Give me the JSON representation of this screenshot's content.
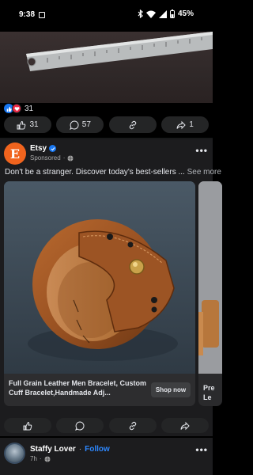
{
  "status_bar": {
    "time": "9:38",
    "battery": "45%"
  },
  "prev_post": {
    "reaction_count": "31",
    "actions": {
      "like_count": "31",
      "comment_count": "57",
      "share_count": "1"
    }
  },
  "ad": {
    "advertiser": "Etsy",
    "avatar_letter": "E",
    "sponsored_label": "Sponsored",
    "body_text": "Don't be a stranger. Discover today's best-sellers ...",
    "see_more": "See more",
    "card": {
      "title": "Full Grain Leather Men Bracelet, Custom Cuff Bracelet,Handmade Adj...",
      "cta": "Shop now"
    },
    "card2": {
      "title_line1": "Pre",
      "title_line2": "Le"
    }
  },
  "next_post": {
    "author": "Staffy Lover",
    "separator": "·",
    "follow_label": "Follow",
    "time": "7h",
    "time_separator": "·"
  },
  "colors": {
    "background": "#000000",
    "card": "#1c1c1e",
    "accent_blue": "#2d88ff",
    "etsy_orange": "#f1641e"
  },
  "icons": [
    "like-icon",
    "comment-icon",
    "link-icon",
    "share-icon",
    "globe-icon",
    "verified-badge-icon",
    "more-icon"
  ]
}
